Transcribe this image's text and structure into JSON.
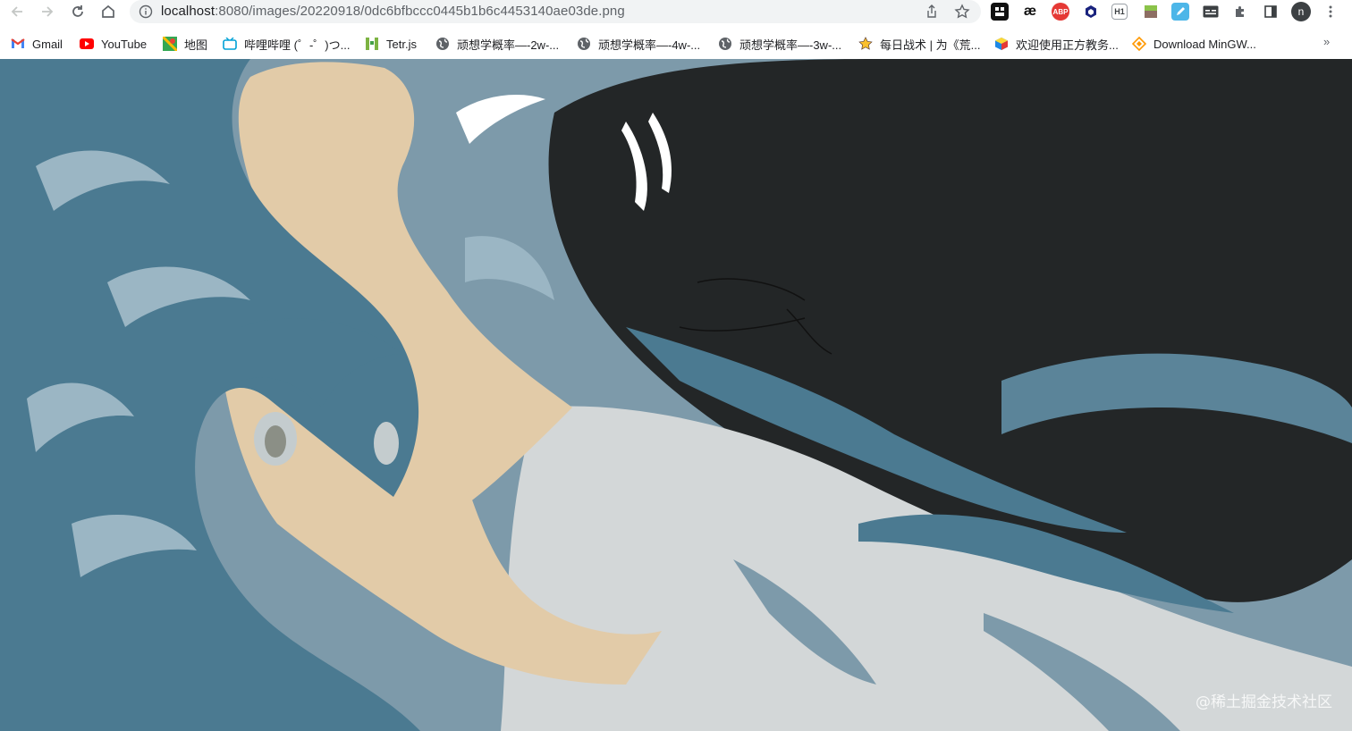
{
  "browser": {
    "url_host": "localhost",
    "url_rest": ":8080/images/20220918/0dc6bfbccc0445b1b6c4453140ae03de.png",
    "profile_initial": "n",
    "extensions": [
      {
        "name": "dark-app-extension",
        "label": "",
        "color": "#111111"
      },
      {
        "name": "ae-extension",
        "label": "æ",
        "color": "#ffffff"
      },
      {
        "name": "abp-extension",
        "label": "ABP",
        "color": "#e53935"
      },
      {
        "name": "hexagon-extension",
        "label": "",
        "color": "#1a237e"
      },
      {
        "name": "h1-extension",
        "label": "H1",
        "color": "#ffffff"
      },
      {
        "name": "grass-extension",
        "label": "",
        "color": "#8bc34a"
      },
      {
        "name": "pen-extension",
        "label": "",
        "color": "#4db6e8"
      },
      {
        "name": "caption-extension",
        "label": "",
        "color": "#3c4043"
      }
    ]
  },
  "bookmarks": [
    {
      "label": "Gmail",
      "icon": "gmail-icon"
    },
    {
      "label": "YouTube",
      "icon": "youtube-icon"
    },
    {
      "label": "地图",
      "icon": "maps-icon"
    },
    {
      "label": "哔哩哔哩 (゜-゜)つ...",
      "icon": "bilibili-icon"
    },
    {
      "label": "Tetr.js",
      "icon": "tetris-icon"
    },
    {
      "label": "顽想学概率—-2w-...",
      "icon": "globe-icon"
    },
    {
      "label": "顽想学概率—-4w-...",
      "icon": "globe-icon"
    },
    {
      "label": "顽想学概率—-3w-...",
      "icon": "globe-icon"
    },
    {
      "label": "每日战术 | 为《荒...",
      "icon": "star-icon"
    },
    {
      "label": "欢迎使用正方教务...",
      "icon": "cube-icon"
    },
    {
      "label": "Download MinGW...",
      "icon": "diamond-icon"
    }
  ],
  "bookmarks_more": "»",
  "watermark": "@稀土掘金技术社区"
}
